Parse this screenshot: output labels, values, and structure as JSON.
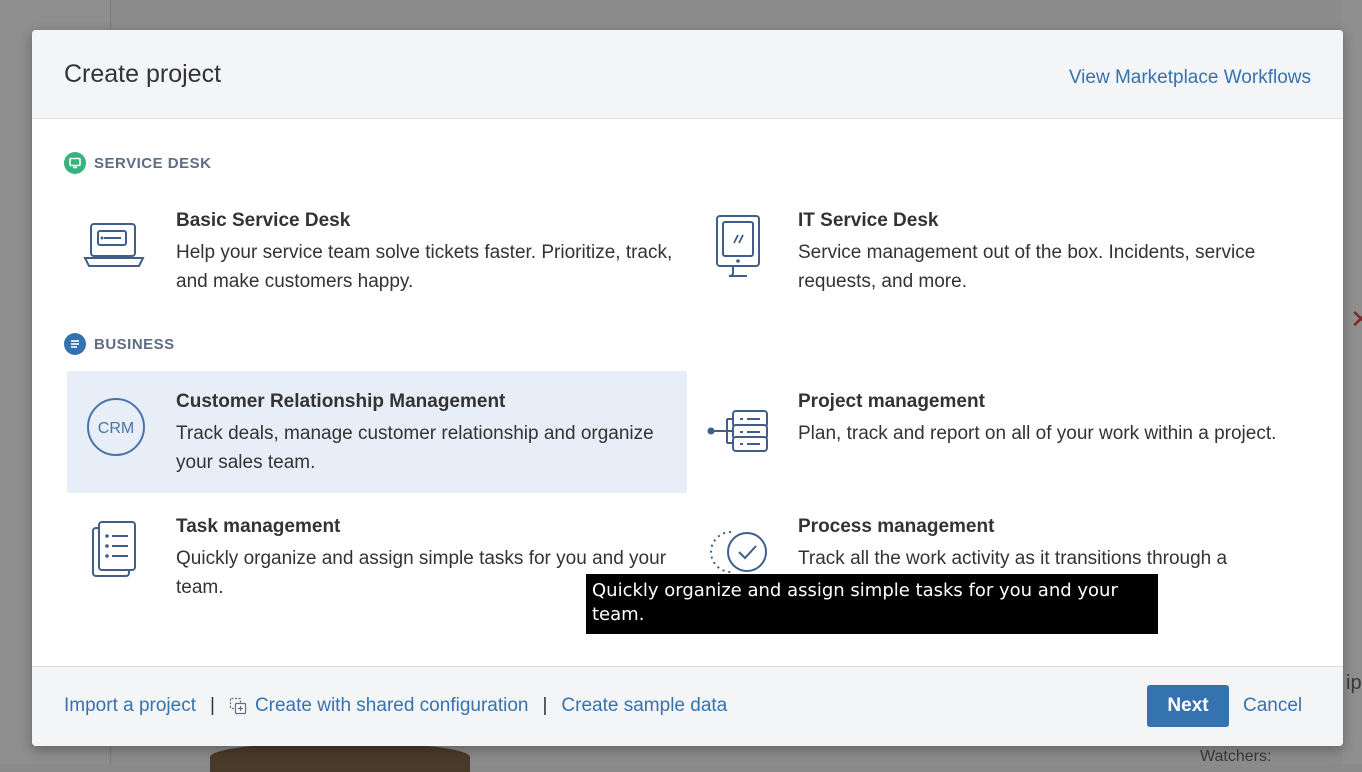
{
  "background": {
    "close_glyph": "✕",
    "text_fragment": "ip",
    "watchers_label": "Watchers:"
  },
  "header": {
    "title": "Create project",
    "marketplace_link": "View Marketplace Workflows"
  },
  "sections": {
    "service_desk": {
      "label": "SERVICE DESK",
      "color": "#36b37e",
      "icon": "monitor-icon"
    },
    "business": {
      "label": "BUSINESS",
      "color": "#3572b0",
      "icon": "list-icon"
    }
  },
  "templates": {
    "basic_service_desk": {
      "name": "Basic Service Desk",
      "description": "Help your service team solve tickets faster. Prioritize, track, and make customers happy.",
      "icon": "laptop-icon"
    },
    "it_service_desk": {
      "name": "IT Service Desk",
      "description": "Service management out of the box. Incidents, service requests, and more.",
      "icon": "monitor-stand-icon"
    },
    "crm": {
      "name": "Customer Relationship Management",
      "description": "Track deals, manage customer relationship and organize your sales team.",
      "icon": "crm-icon",
      "icon_text": "CRM",
      "selected": true
    },
    "project_management": {
      "name": "Project management",
      "description": "Plan, track and report on all of your work within a project.",
      "icon": "hierarchy-icon"
    },
    "task_management": {
      "name": "Task management",
      "description": "Quickly organize and assign simple tasks for you and your team.",
      "icon": "checklist-icon"
    },
    "process_management": {
      "name": "Process management",
      "description": "Track all the work activity as it transitions through a",
      "icon": "check-circle-icon"
    }
  },
  "footer": {
    "import_link": "Import a project",
    "shared_config_link": "Create with shared configuration",
    "sample_data_link": "Create sample data",
    "separator": "|",
    "next_label": "Next",
    "cancel_label": "Cancel"
  },
  "tooltip": {
    "text": "Quickly organize and assign simple tasks for you and your team."
  },
  "colors": {
    "link": "#3572b0",
    "primary_button": "#3572b0",
    "selected_tile": "#e8eef7",
    "icon_stroke": "#3f5f8a"
  }
}
